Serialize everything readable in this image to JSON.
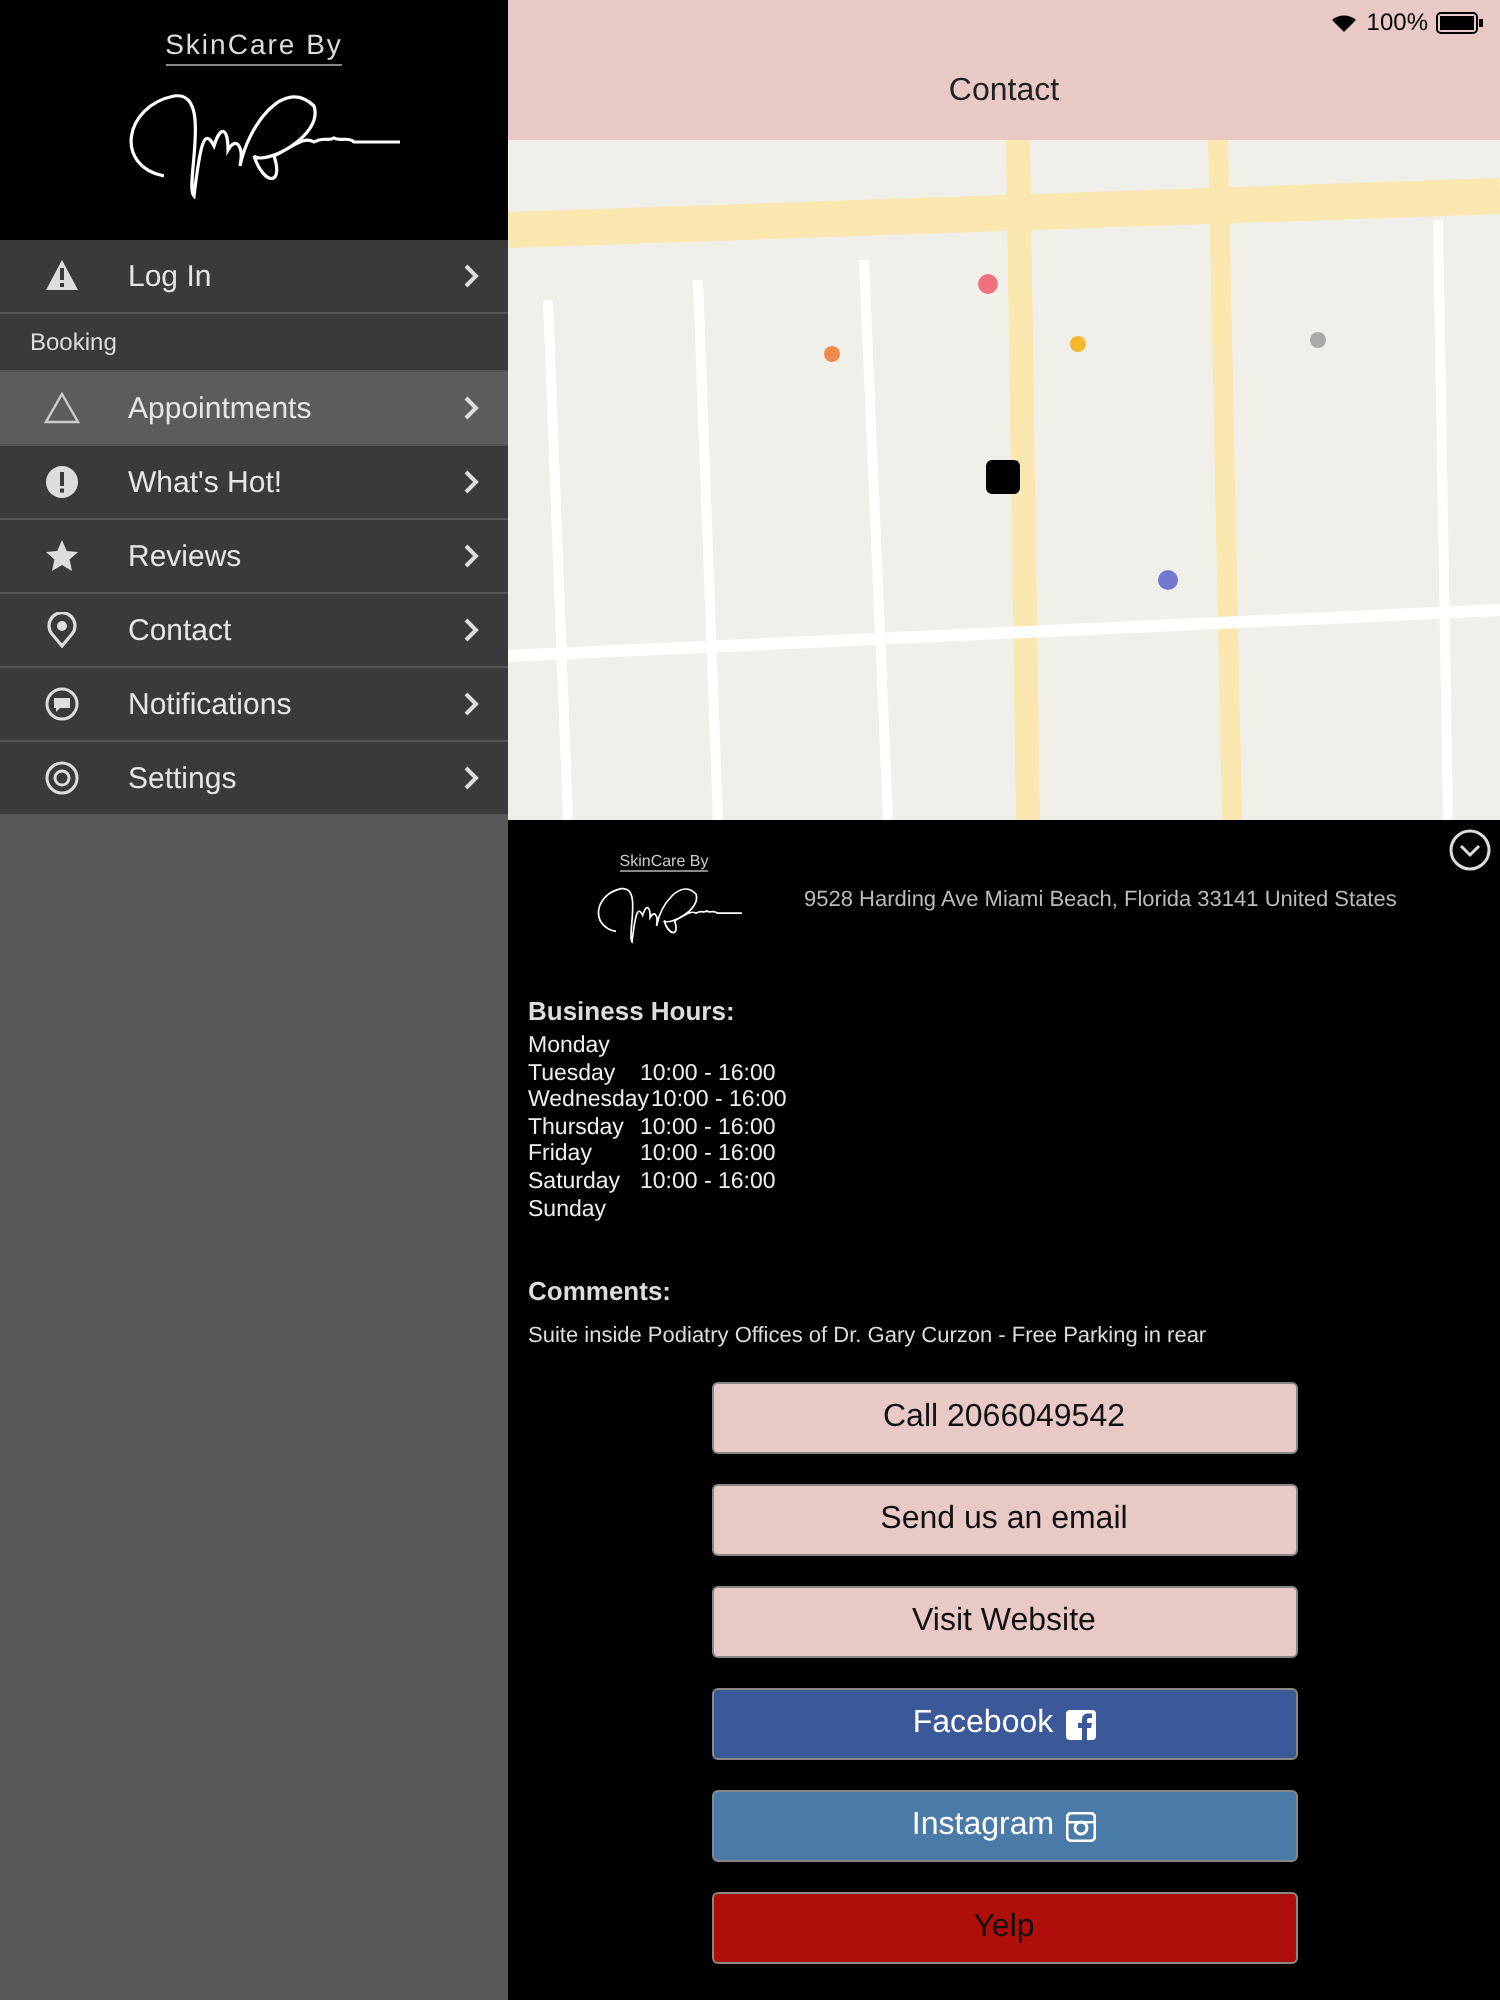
{
  "sidebar": {
    "brand": "SkinCare By",
    "items": [
      {
        "kind": "item",
        "label": "Log In",
        "selected": false
      },
      {
        "kind": "header",
        "label": "Booking"
      },
      {
        "kind": "item",
        "label": "Appointments",
        "selected": true
      },
      {
        "kind": "item",
        "label": "What's Hot!",
        "selected": false
      },
      {
        "kind": "item",
        "label": "Reviews",
        "selected": false
      },
      {
        "kind": "item",
        "label": "Contact",
        "selected": false
      },
      {
        "kind": "item",
        "label": "Notifications",
        "selected": false
      },
      {
        "kind": "item",
        "label": "Settings",
        "selected": false
      }
    ]
  },
  "status_bar": {
    "battery": "100%"
  },
  "nav": {
    "title": "Contact"
  },
  "info": {
    "brand": "SkinCare By",
    "address": "9528 Harding Ave Miami Beach, Florida 33141 United States",
    "hours_title": "Business Hours:",
    "hours": [
      {
        "day": "Monday"
      },
      {
        "day": "Tuesday",
        "time": "10:00 - 16:00"
      },
      {
        "day": "Wednesday",
        "time": "10:00 - 16:00"
      },
      {
        "day": "Thursday",
        "time": "10:00 - 16:00"
      },
      {
        "day": "Friday",
        "time": "10:00 - 16:00"
      },
      {
        "day": "Saturday",
        "time": "10:00 - 16:00"
      },
      {
        "day": "Sunday"
      }
    ],
    "comments_title": "Comments:",
    "comments": "Suite inside Podiatry Offices of Dr. Gary Curzon - Free Parking in rear"
  },
  "buttons": [
    {
      "kind": "plain",
      "label": "Call 2066049542",
      "color": "#e8c9c6"
    },
    {
      "kind": "plain",
      "label": "Send us an email",
      "color": "#e8c9c6"
    },
    {
      "kind": "plain",
      "label": "Visit Website",
      "color": "#e8c9c6"
    },
    {
      "kind": "square-f",
      "label": "Facebook",
      "color": "#3b5998"
    },
    {
      "kind": "camera",
      "label": "Instagram",
      "color": "#4a7aa8"
    },
    {
      "kind": "plain",
      "label": "Yelp",
      "color": "#b00e0b"
    }
  ]
}
